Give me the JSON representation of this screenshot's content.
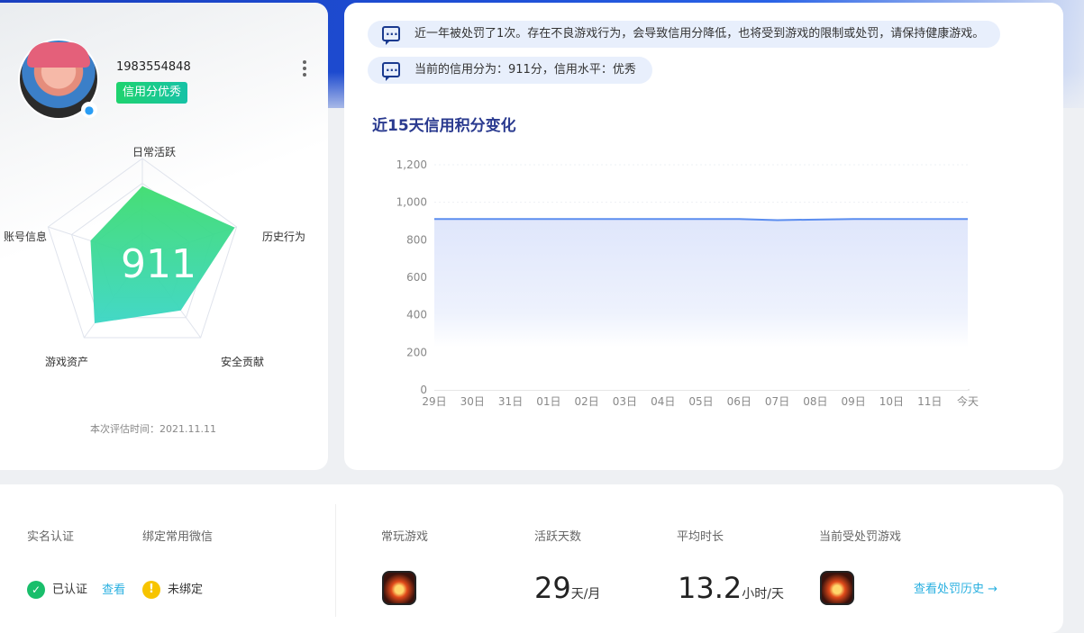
{
  "profile": {
    "uid": "1983554848",
    "credit_badge": "信用分优秀",
    "score": "911",
    "eval_time": "本次评估时间：2021.11.11",
    "radar_labels": {
      "daily": "日常活跃",
      "history": "历史行为",
      "security": "安全贡献",
      "assets": "游戏资产",
      "account": "账号信息"
    },
    "radar_values": {
      "daily": 0.72,
      "history": 0.98,
      "security": 0.66,
      "assets": 0.82,
      "account": 0.55
    }
  },
  "notices": {
    "penalty": "近一年被处罚了1次。存在不良游戏行为，会导致信用分降低，也将受到游戏的限制或处罚，请保持健康游戏。",
    "current": "当前的信用分为：911分，信用水平：优秀"
  },
  "chart_title": "近15天信用积分变化",
  "chart_data": {
    "type": "area",
    "categories": [
      "29日",
      "30日",
      "31日",
      "01日",
      "02日",
      "03日",
      "04日",
      "05日",
      "06日",
      "07日",
      "08日",
      "09日",
      "10日",
      "11日",
      "今天"
    ],
    "values": [
      911,
      911,
      911,
      911,
      911,
      911,
      911,
      911,
      911,
      905,
      908,
      911,
      911,
      911,
      911
    ],
    "yticks": [
      "0",
      "200",
      "400",
      "600",
      "800",
      "1,000",
      "1,200"
    ],
    "ylim": [
      0,
      1200
    ],
    "grid": true,
    "line_color": "#5b8def",
    "fill_color": "#dfe6fb"
  },
  "bottom": {
    "realname_label": "实名认证",
    "wechat_label": "绑定常用微信",
    "verified_text": "已认证",
    "view_link": "查看",
    "unbound_text": "未绑定",
    "frequent_game_label": "常玩游戏",
    "active_days_label": "活跃天数",
    "avg_time_label": "平均时长",
    "punished_game_label": "当前受处罚游戏",
    "active_days": "29",
    "active_days_unit": "天/月",
    "avg_time": "13.2",
    "avg_time_unit": "小时/天",
    "history_link": "查看处罚历史 →"
  }
}
